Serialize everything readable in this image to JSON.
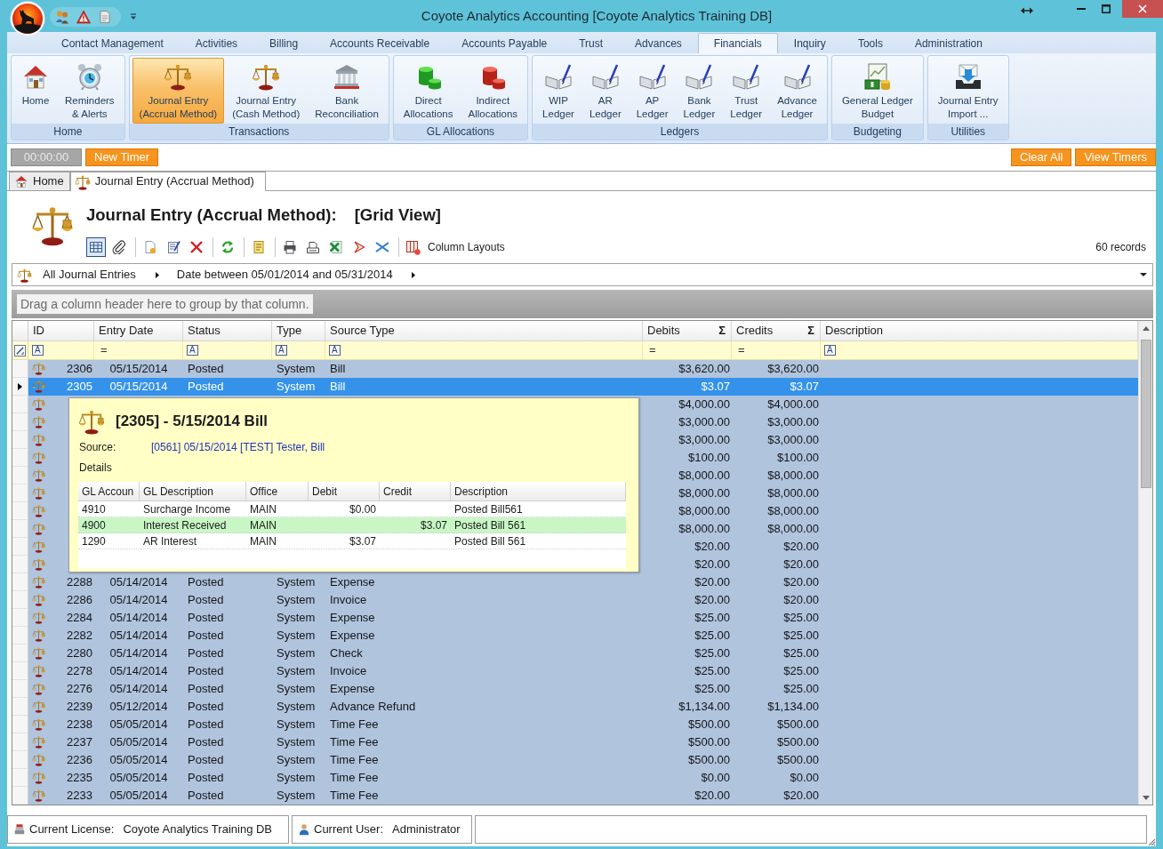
{
  "window": {
    "title": "Coyote Analytics Accounting [Coyote Analytics Training DB]"
  },
  "ribbon": {
    "tabs": [
      {
        "label": "Contact Management",
        "selected": false
      },
      {
        "label": "Activities",
        "selected": false
      },
      {
        "label": "Billing",
        "selected": false
      },
      {
        "label": "Accounts Receivable",
        "selected": false
      },
      {
        "label": "Accounts Payable",
        "selected": false
      },
      {
        "label": "Trust",
        "selected": false
      },
      {
        "label": "Advances",
        "selected": false
      },
      {
        "label": "Financials",
        "selected": true
      },
      {
        "label": "Inquiry",
        "selected": false
      },
      {
        "label": "Tools",
        "selected": false
      },
      {
        "label": "Administration",
        "selected": false
      }
    ],
    "groups": [
      {
        "label": "Home",
        "buttons": [
          {
            "label": "Home",
            "selected": false
          },
          {
            "label": "Reminders\n& Alerts",
            "selected": false
          }
        ]
      },
      {
        "label": "Transactions",
        "buttons": [
          {
            "label": "Journal Entry\n(Accrual Method)",
            "selected": true
          },
          {
            "label": "Journal Entry\n(Cash Method)",
            "selected": false
          },
          {
            "label": "Bank\nReconciliation",
            "selected": false
          }
        ]
      },
      {
        "label": "GL Allocations",
        "buttons": [
          {
            "label": "Direct\nAllocations",
            "selected": false
          },
          {
            "label": "Indirect\nAllocations",
            "selected": false
          }
        ]
      },
      {
        "label": "Ledgers",
        "buttons": [
          {
            "label": "WIP\nLedger",
            "selected": false
          },
          {
            "label": "AR\nLedger",
            "selected": false
          },
          {
            "label": "AP\nLedger",
            "selected": false
          },
          {
            "label": "Bank\nLedger",
            "selected": false
          },
          {
            "label": "Trust\nLedger",
            "selected": false
          },
          {
            "label": "Advance\nLedger",
            "selected": false
          }
        ]
      },
      {
        "label": "Budgeting",
        "buttons": [
          {
            "label": "General Ledger\nBudget",
            "selected": false
          }
        ]
      },
      {
        "label": "Utilities",
        "buttons": [
          {
            "label": "Journal Entry\nImport ...",
            "selected": false
          }
        ]
      }
    ]
  },
  "timer_bar": {
    "elapsed": "00:00:00",
    "left_buttons": [
      "New Timer"
    ],
    "right_buttons": [
      "Clear All",
      "View Timers"
    ]
  },
  "document_tabs": [
    {
      "label": "Home",
      "selected": false
    },
    {
      "label": "Journal Entry (Accrual Method)",
      "selected": true
    }
  ],
  "page": {
    "title": "Journal Entry (Accrual Method):",
    "view": "[Grid View]",
    "toolbar": {
      "grid_view": {
        "selected": true
      },
      "column_layouts": "Column Layouts"
    },
    "record_count": "60 records"
  },
  "filter_bar": {
    "items": [
      "All Journal Entries",
      "Date between 05/01/2014 and 05/31/2014"
    ]
  },
  "group_panel": {
    "hint": "Drag a column header here to group by that column."
  },
  "grid": {
    "columns": [
      {
        "label": "ID",
        "kind": "text",
        "filter_mark": "A"
      },
      {
        "label": "Entry Date",
        "kind": "number",
        "filter_mark": "="
      },
      {
        "label": "Status",
        "kind": "text",
        "filter_mark": "A"
      },
      {
        "label": "Type",
        "kind": "text",
        "filter_mark": "A"
      },
      {
        "label": "Source Type",
        "kind": "text",
        "filter_mark": "A"
      },
      {
        "label": "Debits",
        "kind": "number",
        "filter_mark": "=",
        "sum_mark": "Σ"
      },
      {
        "label": "Credits",
        "kind": "number",
        "filter_mark": "=",
        "sum_mark": "Σ"
      },
      {
        "label": "Description",
        "kind": "text",
        "filter_mark": "A"
      }
    ],
    "rows": [
      {
        "id": "2306",
        "entry_date": "05/15/2014",
        "status": "Posted",
        "type": "System",
        "source_type": "Bill",
        "debits": "$3,620.00",
        "credits": "$3,620.00",
        "selected": false
      },
      {
        "id": "2305",
        "entry_date": "05/15/2014",
        "status": "Posted",
        "type": "System",
        "source_type": "Bill",
        "debits": "$3.07",
        "credits": "$3.07",
        "selected": true
      },
      {
        "debits": "$4,000.00",
        "credits": "$4,000.00",
        "selected": false
      },
      {
        "debits": "$3,000.00",
        "credits": "$3,000.00",
        "selected": false
      },
      {
        "debits": "$3,000.00",
        "credits": "$3,000.00",
        "selected": false
      },
      {
        "debits": "$100.00",
        "credits": "$100.00",
        "selected": false
      },
      {
        "debits": "$8,000.00",
        "credits": "$8,000.00",
        "selected": false
      },
      {
        "debits": "$8,000.00",
        "credits": "$8,000.00",
        "selected": false
      },
      {
        "debits": "$8,000.00",
        "credits": "$8,000.00",
        "selected": false
      },
      {
        "debits": "$8,000.00",
        "credits": "$8,000.00",
        "selected": false
      },
      {
        "debits": "$20.00",
        "credits": "$20.00",
        "selected": false
      },
      {
        "debits": "$20.00",
        "credits": "$20.00",
        "selected": false
      },
      {
        "id": "2288",
        "entry_date": "05/14/2014",
        "status": "Posted",
        "type": "System",
        "source_type": "Expense",
        "debits": "$20.00",
        "credits": "$20.00",
        "selected": false
      },
      {
        "id": "2286",
        "entry_date": "05/14/2014",
        "status": "Posted",
        "type": "System",
        "source_type": "Invoice",
        "debits": "$20.00",
        "credits": "$20.00",
        "selected": false
      },
      {
        "id": "2284",
        "entry_date": "05/14/2014",
        "status": "Posted",
        "type": "System",
        "source_type": "Expense",
        "debits": "$25.00",
        "credits": "$25.00",
        "selected": false
      },
      {
        "id": "2282",
        "entry_date": "05/14/2014",
        "status": "Posted",
        "type": "System",
        "source_type": "Expense",
        "debits": "$25.00",
        "credits": "$25.00",
        "selected": false
      },
      {
        "id": "2280",
        "entry_date": "05/14/2014",
        "status": "Posted",
        "type": "System",
        "source_type": "Check",
        "debits": "$25.00",
        "credits": "$25.00",
        "selected": false
      },
      {
        "id": "2278",
        "entry_date": "05/14/2014",
        "status": "Posted",
        "type": "System",
        "source_type": "Invoice",
        "debits": "$25.00",
        "credits": "$25.00",
        "selected": false
      },
      {
        "id": "2276",
        "entry_date": "05/14/2014",
        "status": "Posted",
        "type": "System",
        "source_type": "Expense",
        "debits": "$25.00",
        "credits": "$25.00",
        "selected": false
      },
      {
        "id": "2239",
        "entry_date": "05/12/2014",
        "status": "Posted",
        "type": "System",
        "source_type": "Advance Refund",
        "debits": "$1,134.00",
        "credits": "$1,134.00",
        "selected": false
      },
      {
        "id": "2238",
        "entry_date": "05/05/2014",
        "status": "Posted",
        "type": "System",
        "source_type": "Time Fee",
        "debits": "$500.00",
        "credits": "$500.00",
        "selected": false
      },
      {
        "id": "2237",
        "entry_date": "05/05/2014",
        "status": "Posted",
        "type": "System",
        "source_type": "Time Fee",
        "debits": "$500.00",
        "credits": "$500.00",
        "selected": false
      },
      {
        "id": "2236",
        "entry_date": "05/05/2014",
        "status": "Posted",
        "type": "System",
        "source_type": "Time Fee",
        "debits": "$500.00",
        "credits": "$500.00",
        "selected": false
      },
      {
        "id": "2235",
        "entry_date": "05/05/2014",
        "status": "Posted",
        "type": "System",
        "source_type": "Time Fee",
        "debits": "$0.00",
        "credits": "$0.00",
        "selected": false
      },
      {
        "id": "2233",
        "entry_date": "05/05/2014",
        "status": "Posted",
        "type": "System",
        "source_type": "Time Fee",
        "debits": "$20.00",
        "credits": "$20.00",
        "selected": false
      }
    ]
  },
  "tooltip": {
    "title": "[2305] - 5/15/2014 Bill",
    "source_label": "Source:",
    "source_link": "[0561] 05/15/2014 [TEST] Tester, Bill",
    "details_label": "Details",
    "table": {
      "columns": [
        "GL Accoun",
        "GL Description",
        "Office",
        "Debit",
        "Credit",
        "Description"
      ],
      "rows": [
        {
          "gl_account": "4910",
          "gl_description": "Surcharge Income",
          "office": "MAIN",
          "debit": "$0.00",
          "description": "Posted Bill561",
          "selected": false
        },
        {
          "gl_account": "4900",
          "gl_description": "Interest Received",
          "office": "MAIN",
          "credit": "$3.07",
          "description": "Posted Bill 561",
          "selected": true
        },
        {
          "gl_account": "1290",
          "gl_description": "AR Interest",
          "office": "MAIN",
          "debit": "$3.07",
          "description": "Posted Bill 561",
          "selected": false
        }
      ]
    }
  },
  "status_bar": {
    "panels": [
      {
        "label": "Current License:",
        "value": "Coyote Analytics Training DB"
      },
      {
        "label": "Current User:",
        "value": "Administrator"
      }
    ]
  }
}
